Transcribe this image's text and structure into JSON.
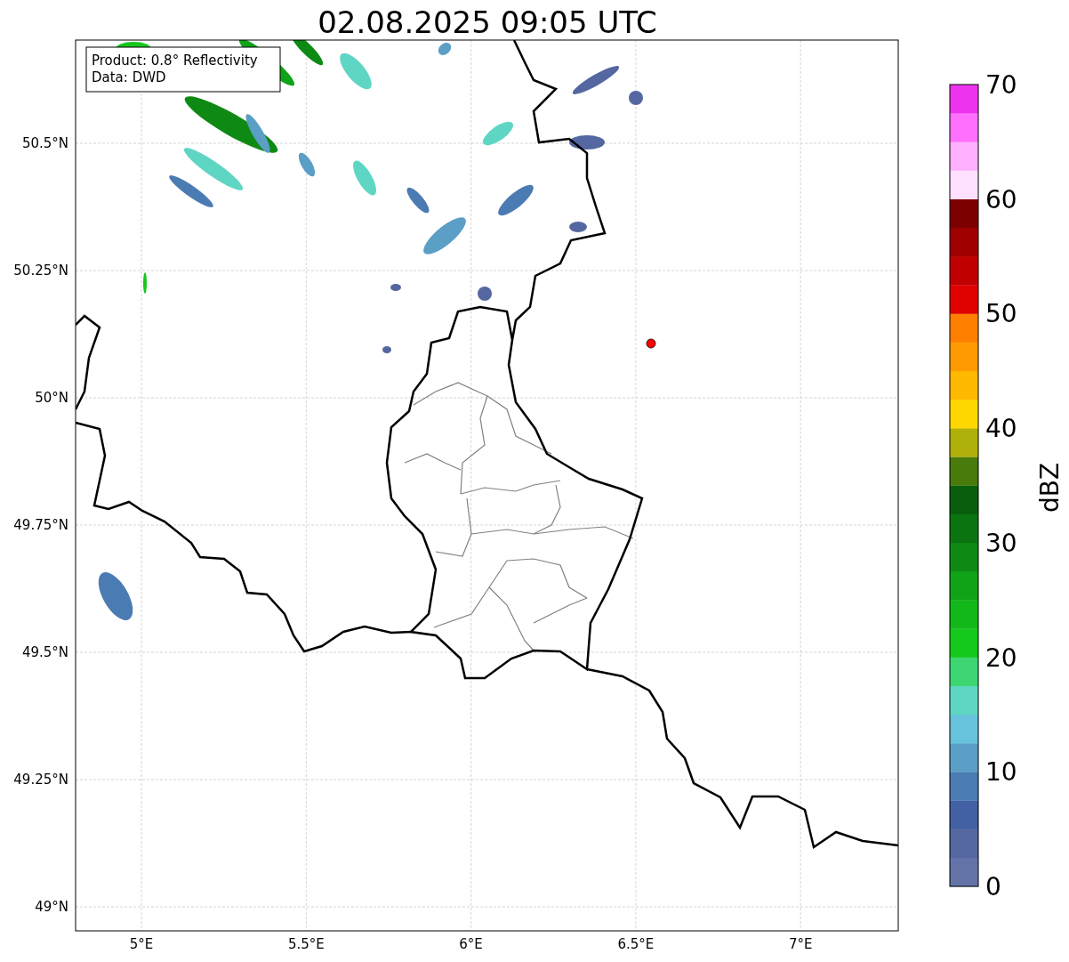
{
  "title": "02.08.2025 09:05 UTC",
  "info_box": [
    "Product: 0.8° Reflectivity",
    "Data: DWD"
  ],
  "y_ticks": [
    "50.5°N",
    "50.25°N",
    "50°N",
    "49.75°N",
    "49.5°N",
    "49.25°N",
    "49°N"
  ],
  "x_ticks": [
    "5°E",
    "5.5°E",
    "6°E",
    "6.5°E",
    "7°E"
  ],
  "colorbar": {
    "label": "dBZ",
    "ticks": [
      "70",
      "60",
      "50",
      "40",
      "30",
      "20",
      "10",
      "0"
    ],
    "bins": [
      {
        "color": "#6474a8"
      },
      {
        "color": "#5467a0"
      },
      {
        "color": "#4260a3"
      },
      {
        "color": "#4b7bb3"
      },
      {
        "color": "#5b9ec6"
      },
      {
        "color": "#67c3dc"
      },
      {
        "color": "#5fd6c4"
      },
      {
        "color": "#3dd672"
      },
      {
        "color": "#14c81c"
      },
      {
        "color": "#12b81a"
      },
      {
        "color": "#10a318"
      },
      {
        "color": "#0e8a14"
      },
      {
        "color": "#0a7510"
      },
      {
        "color": "#085e0c"
      },
      {
        "color": "#487a0c"
      },
      {
        "color": "#b0b00a"
      },
      {
        "color": "#ffd700"
      },
      {
        "color": "#ffb900"
      },
      {
        "color": "#ff9b00"
      },
      {
        "color": "#ff8000"
      },
      {
        "color": "#e00000"
      },
      {
        "color": "#c00000"
      },
      {
        "color": "#a00000"
      },
      {
        "color": "#7c0000"
      },
      {
        "color": "#ffe0ff"
      },
      {
        "color": "#ffb0ff"
      },
      {
        "color": "#ff70ff"
      },
      {
        "color": "#ee33ee"
      }
    ]
  }
}
